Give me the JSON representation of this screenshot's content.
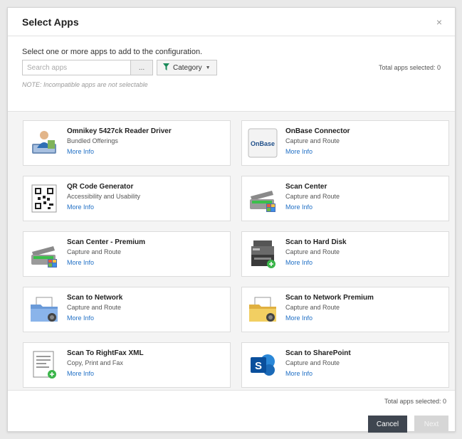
{
  "dialog": {
    "title": "Select Apps",
    "close_glyph": "×",
    "instruction": "Select one or more apps to add to the configuration.",
    "search": {
      "placeholder": "Search apps",
      "button_label": "..."
    },
    "category_button": {
      "label": "Category",
      "icon": "funnel-icon",
      "caret_icon": "caret-down-icon"
    },
    "total_selected_top": "Total apps selected: 0",
    "note": "NOTE: Incompatible apps are not selectable",
    "total_selected_bottom": "Total apps selected: 0",
    "buttons": {
      "cancel": "Cancel",
      "next": "Next"
    }
  },
  "apps": [
    {
      "name": "Omnikey 5427ck Reader Driver",
      "category": "Bundled Offerings",
      "more": "More Info",
      "icon": "omnikey-reader-icon",
      "icon_text": ""
    },
    {
      "name": "OnBase Connector",
      "category": "Capture and Route",
      "more": "More Info",
      "icon": "onbase-logo-icon",
      "icon_text": "OnBase"
    },
    {
      "name": "QR Code Generator",
      "category": "Accessibility and Usability",
      "more": "More Info",
      "icon": "qr-code-icon",
      "icon_text": ""
    },
    {
      "name": "Scan Center",
      "category": "Capture and Route",
      "more": "More Info",
      "icon": "scanner-icon",
      "icon_text": ""
    },
    {
      "name": "Scan Center - Premium",
      "category": "Capture and Route",
      "more": "More Info",
      "icon": "scanner-icon",
      "icon_text": ""
    },
    {
      "name": "Scan to Hard Disk",
      "category": "Capture and Route",
      "more": "More Info",
      "icon": "printer-disk-icon",
      "icon_text": ""
    },
    {
      "name": "Scan to Network",
      "category": "Capture and Route",
      "more": "More Info",
      "icon": "network-folder-icon",
      "icon_text": ""
    },
    {
      "name": "Scan to Network Premium",
      "category": "Capture and Route",
      "more": "More Info",
      "icon": "network-folder-premium-icon",
      "icon_text": ""
    },
    {
      "name": "Scan To RightFax XML",
      "category": "Copy, Print and Fax",
      "more": "More Info",
      "icon": "fax-document-icon",
      "icon_text": ""
    },
    {
      "name": "Scan to SharePoint",
      "category": "Capture and Route",
      "more": "More Info",
      "icon": "sharepoint-icon",
      "icon_text": "S"
    }
  ],
  "colors": {
    "link": "#1f6fc5",
    "primary_button": "#3f4650",
    "disabled_button": "#d6d6d6",
    "filter_icon": "#1a8a5a"
  }
}
